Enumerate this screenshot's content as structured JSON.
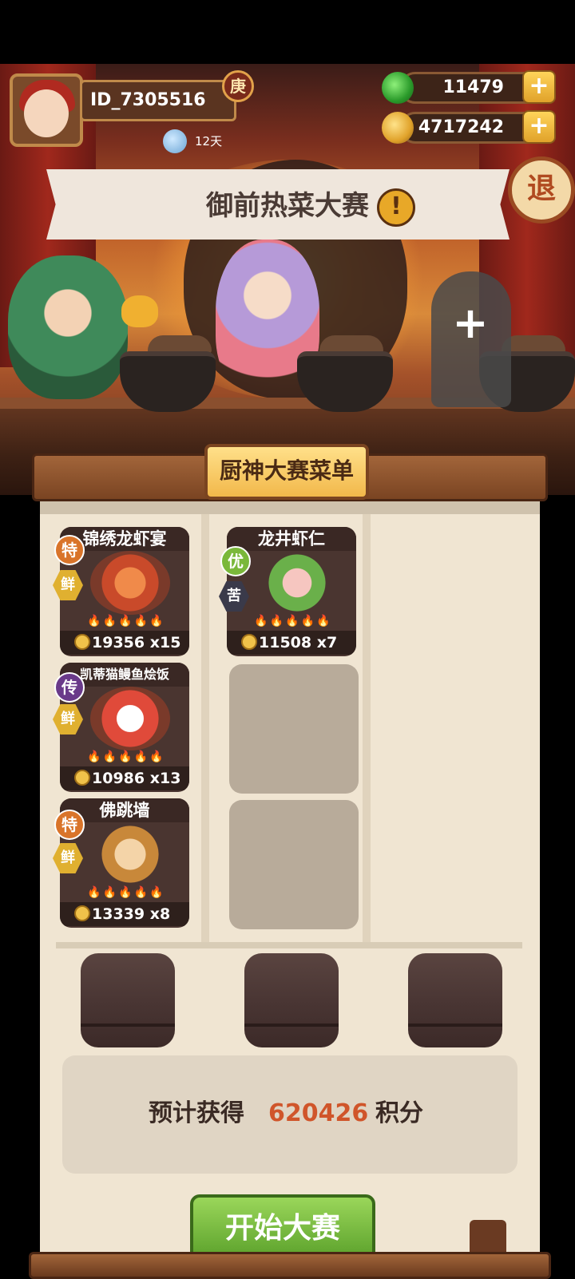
{
  "player": {
    "id": "ID_7305516",
    "rank_badge": "庚",
    "days": "12天"
  },
  "currency": {
    "jade": "11479",
    "coins": "4717242",
    "plus": "+"
  },
  "exit_label": "退",
  "event": {
    "title": "御前热菜大赛",
    "alert": "!"
  },
  "menu_tab": "厨神大赛菜单",
  "empty_slot_plus": "+",
  "dishes": [
    {
      "name": "锦绣龙虾宴",
      "quality": "特",
      "flavor": "鲜",
      "price": "19356",
      "qty": "x15",
      "fires": "🔥🔥🔥🔥🔥"
    },
    {
      "name": "龙井虾仁",
      "quality": "优",
      "flavor": "苦",
      "price": "11508",
      "qty": "x7",
      "fires": "🔥🔥🔥🔥🔥"
    },
    {
      "name": "凯蒂猫鳗鱼烩饭",
      "quality": "传",
      "flavor": "鲜",
      "price": "10986",
      "qty": "x13",
      "fires": "🔥🔥🔥🔥🔥"
    },
    {
      "name": "佛跳墙",
      "quality": "特",
      "flavor": "鲜",
      "price": "13339",
      "qty": "x8",
      "fires": "🔥🔥🔥🔥🔥"
    }
  ],
  "score": {
    "label": "预计获得",
    "value": "620426",
    "unit": "积分"
  },
  "start_button": "开始大赛",
  "colors": {
    "accent_orange": "#d0552a",
    "start_green": "#5aa02a",
    "panel_bg": "#f0e5d2"
  }
}
